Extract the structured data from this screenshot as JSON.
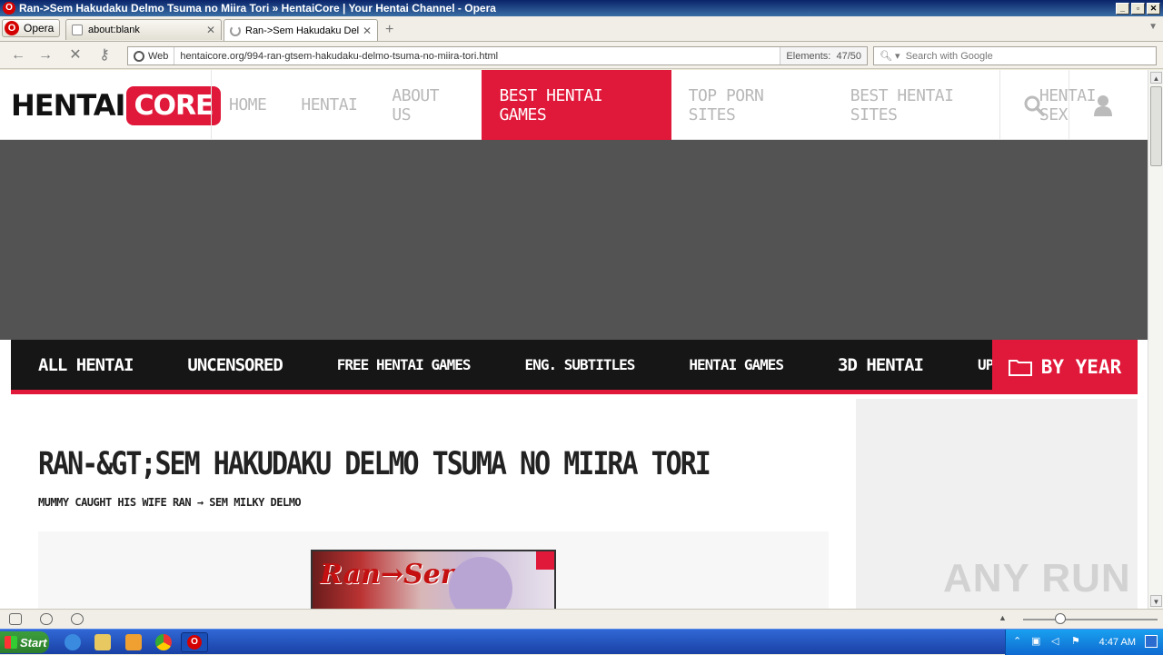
{
  "window": {
    "title": "Ran->Sem Hakudaku Delmo Tsuma no Miira Tori » HentaiCore | Your Hentai Channel - Opera",
    "controls": [
      "_",
      "▫",
      "✕"
    ]
  },
  "tabs": {
    "menu_label": "Opera",
    "items": [
      {
        "label": "about:blank",
        "active": false
      },
      {
        "label": "Ran->Sem Hakudaku Del...",
        "active": true
      }
    ],
    "new_tab_glyph": "+",
    "scroll_glyph": "▼"
  },
  "address_bar": {
    "web_label": "Web",
    "url": "hentaicore.org/994-ran-gtsem-hakudaku-delmo-tsuma-no-miira-tori.html",
    "elements_label": "Elements:",
    "elements_value": "47/50",
    "search_placeholder": "Search with Google"
  },
  "site": {
    "logo_left": "HENTAI",
    "logo_right": "CORE",
    "nav": [
      "HOME",
      "HENTAI",
      "ABOUT US",
      "BEST HENTAI GAMES",
      "TOP PORN SITES",
      "BEST HENTAI SITES",
      "HENTAI SEX"
    ],
    "nav_active_index": 3,
    "categories": [
      "ALL HENTAI",
      "UNCENSORED",
      "FREE HENTAI GAMES",
      "ENG. SUBTITLES",
      "HENTAI GAMES",
      "3D HENTAI",
      "UPCOMING"
    ],
    "by_year_label": "BY YEAR",
    "post_title": "RAN-&GT;SEM HAKUDAKU DELMO TSUMA NO MIIRA TORI",
    "post_subtitle": "MUMMY CAUGHT HIS WIFE RAN → SEM MILKY DELMO",
    "cover_text": "Ran→Sem",
    "accent_color": "#e0183a",
    "dark_color": "#161616"
  },
  "watermark": "ANY RUN",
  "taskbar": {
    "start_label": "Start",
    "clock": "4:47 AM"
  }
}
